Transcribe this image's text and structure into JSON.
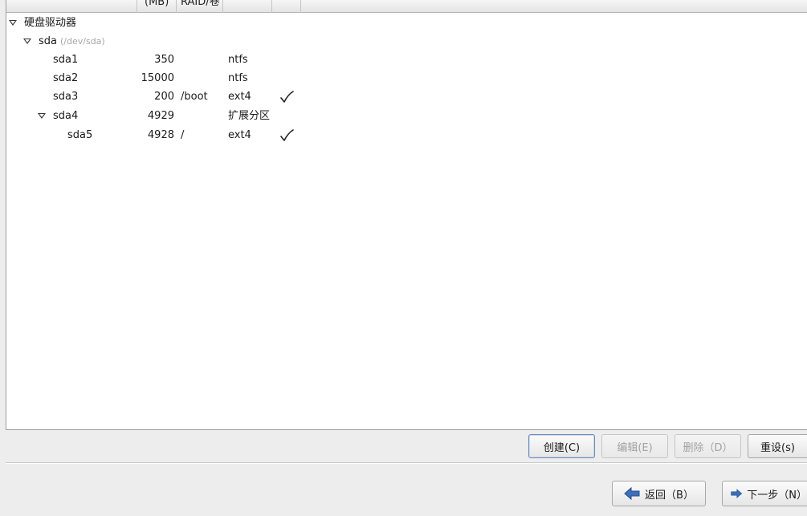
{
  "columns": {
    "size": "(MB)",
    "raid": "RAID/卷"
  },
  "tree": {
    "root_label": "硬盘驱动器",
    "disk": {
      "name": "sda",
      "path": "(/dev/sda)"
    },
    "partitions": [
      {
        "name": "sda1",
        "size": "350",
        "mount": "",
        "type": "ntfs",
        "format": false
      },
      {
        "name": "sda2",
        "size": "15000",
        "mount": "",
        "type": "ntfs",
        "format": false
      },
      {
        "name": "sda3",
        "size": "200",
        "mount": "/boot",
        "type": "ext4",
        "format": true
      },
      {
        "name": "sda4",
        "size": "4929",
        "mount": "",
        "type": "扩展分区",
        "format": false
      },
      {
        "name": "sda5",
        "size": "4928",
        "mount": "/",
        "type": "ext4",
        "format": true
      }
    ]
  },
  "actions": {
    "create": "创建(C)",
    "edit": "编辑(E)",
    "delete": "删除（D）",
    "reset": "重设(s)"
  },
  "nav": {
    "back": "返回（B）",
    "next": "下一步（N）"
  },
  "colors": {
    "accent": "#6c8bb5",
    "arrow": "#3f6fb8"
  }
}
